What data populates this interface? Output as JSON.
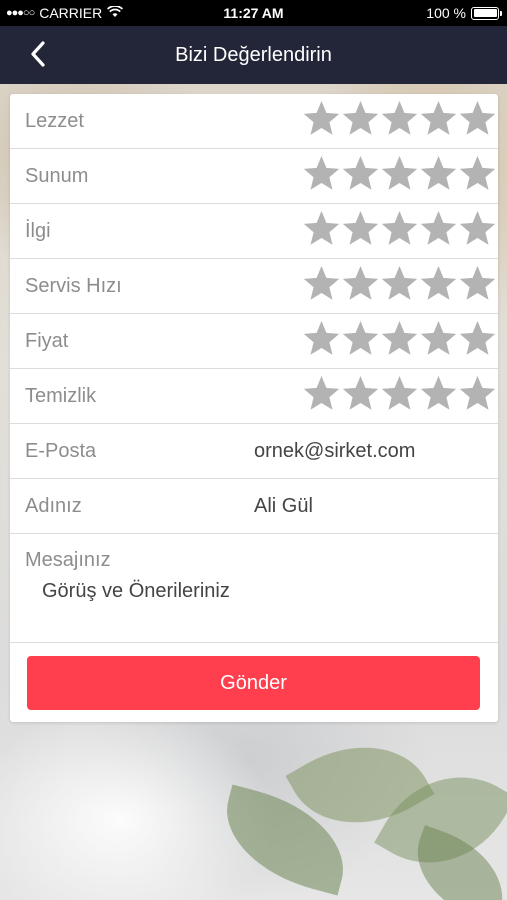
{
  "status_bar": {
    "carrier": "CARRIER",
    "time": "11:27 AM",
    "battery": "100 %",
    "battery_level": 1.0
  },
  "nav": {
    "title": "Bizi Değerlendirin",
    "back_icon": "chevron-left-icon"
  },
  "ratings": [
    {
      "label": "Lezzet",
      "stars": 0,
      "max": 5
    },
    {
      "label": "Sunum",
      "stars": 0,
      "max": 5
    },
    {
      "label": "İlgi",
      "stars": 0,
      "max": 5
    },
    {
      "label": "Servis Hızı",
      "stars": 0,
      "max": 5
    },
    {
      "label": "Fiyat",
      "stars": 0,
      "max": 5
    },
    {
      "label": "Temizlik",
      "stars": 0,
      "max": 5
    }
  ],
  "fields": {
    "email": {
      "label": "E-Posta",
      "placeholder": "ornek@sirket.com"
    },
    "name": {
      "label": "Adınız",
      "placeholder": "Ali Gül"
    },
    "message": {
      "label": "Mesajınız",
      "placeholder": "Görüş ve Önerileriniz"
    }
  },
  "submit_label": "Gönder",
  "colors": {
    "nav_bg": "#232638",
    "accent": "#ff3e4e",
    "star_empty": "#b3b3b3",
    "label": "#8d8d8d"
  }
}
